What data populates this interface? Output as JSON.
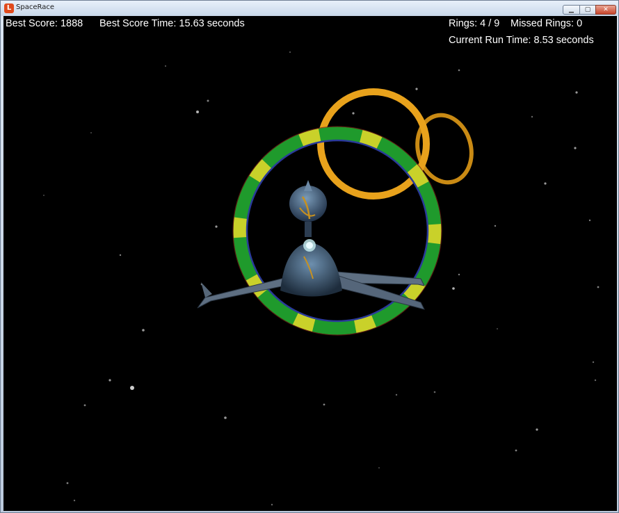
{
  "window": {
    "title": "SpaceRace",
    "app_icon_glyph": "L",
    "controls": {
      "minimize_glyph": "▁",
      "maximize_glyph": "▢",
      "close_glyph": "✕"
    }
  },
  "hud": {
    "best_score": "Best Score: 1888",
    "best_score_time": "Best Score Time: 15.63 seconds",
    "rings": "Rings: 4 / 9",
    "missed_rings": "Missed Rings: 0",
    "current_run_time": "Current Run Time: 8.53 seconds"
  },
  "colors": {
    "space": "#000000",
    "near_ring_green": "#1f9a2c",
    "near_ring_yellow": "#c9d12a",
    "far_ring_orange": "#e8a21c",
    "ship_body": "#4a6a8a",
    "ship_wing": "#6c7f95"
  }
}
